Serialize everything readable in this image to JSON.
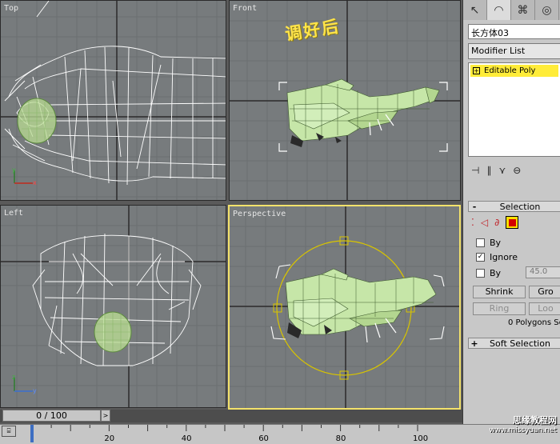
{
  "viewports": {
    "top": "Top",
    "front": "Front",
    "left": "Left",
    "perspective": "Perspective"
  },
  "annotation": "调好后",
  "panel": {
    "tabs": [
      "create-icon",
      "modify-icon",
      "hierarchy-icon",
      "motion-icon"
    ],
    "object_name": "长方体03",
    "modifier_list": "Modifier List",
    "stack_item": "Editable Poly",
    "selection_rollout": "Selection",
    "by_vertex": "By",
    "ignore": "Ignore",
    "by_angle": "By",
    "angle_value": "45.0",
    "shrink": "Shrink",
    "grow": "Gro",
    "ring": "Ring",
    "loop": "Loo",
    "poly_count": "0 Polygons Se",
    "soft_selection": "Soft Selection"
  },
  "timeline": {
    "frame": "0 / 100",
    "ticks": [
      "20",
      "40",
      "60",
      "80",
      "100"
    ],
    "frame_ticks": [
      20,
      40,
      60,
      80,
      100
    ],
    "range_end": 100
  },
  "watermark": {
    "site": "思缘教程网",
    "url": "www.missyuan.net"
  },
  "colors": {
    "viewport_bg": "#777b7d",
    "active_border": "#f3e26b",
    "wire": "#ffffff",
    "mesh_green": "#c6e6a8",
    "gizmo": "#d8c400",
    "stack_highlight": "#ffec39"
  }
}
